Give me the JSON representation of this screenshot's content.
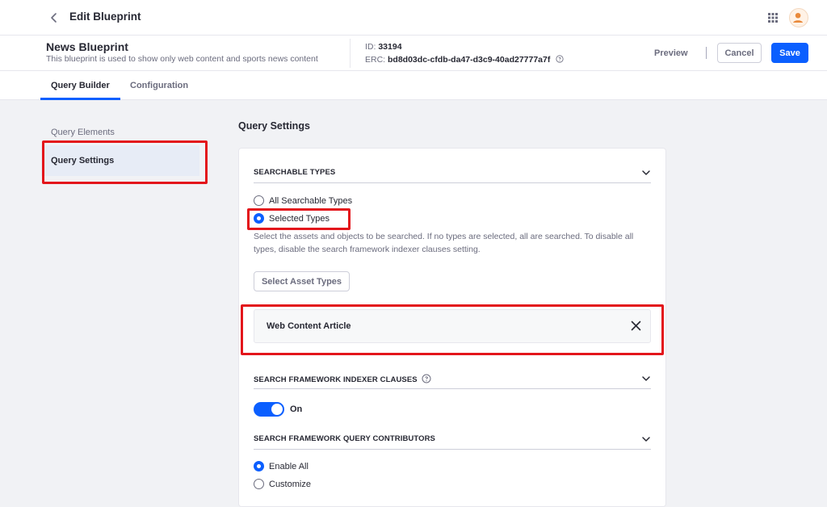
{
  "header": {
    "title": "Edit Blueprint"
  },
  "blueprint": {
    "name": "News Blueprint",
    "description": "This blueprint is used to show only web content and sports news content",
    "id_label": "ID:",
    "id_value": "33194",
    "erc_label": "ERC:",
    "erc_value": "bd8d03dc-cfdb-da47-d3c9-40ad27777a7f"
  },
  "actions": {
    "preview": "Preview",
    "cancel": "Cancel",
    "save": "Save"
  },
  "tabs": [
    {
      "label": "Query Builder",
      "active": true
    },
    {
      "label": "Configuration",
      "active": false
    }
  ],
  "sidebar": {
    "items": [
      {
        "label": "Query Elements",
        "active": false
      },
      {
        "label": "Query Settings",
        "active": true
      }
    ]
  },
  "main": {
    "title": "Query Settings",
    "searchable_types": {
      "label": "SEARCHABLE TYPES",
      "options": [
        {
          "label": "All Searchable Types",
          "checked": false
        },
        {
          "label": "Selected Types",
          "checked": true
        }
      ],
      "help": "Select the assets and objects to be searched. If no types are selected, all are searched. To disable all types, disable the search framework indexer clauses setting.",
      "select_button": "Select Asset Types",
      "selected_items": [
        "Web Content Article"
      ]
    },
    "indexer_clauses": {
      "label": "SEARCH FRAMEWORK INDEXER CLAUSES",
      "toggle_on": true,
      "toggle_label": "On"
    },
    "query_contributors": {
      "label": "SEARCH FRAMEWORK QUERY CONTRIBUTORS",
      "options": [
        {
          "label": "Enable All",
          "checked": true
        },
        {
          "label": "Customize",
          "checked": false
        }
      ]
    }
  },
  "colors": {
    "primary": "#0b5fff",
    "highlight": "#e3151b",
    "text": "#272833",
    "muted": "#6b6c7e"
  }
}
